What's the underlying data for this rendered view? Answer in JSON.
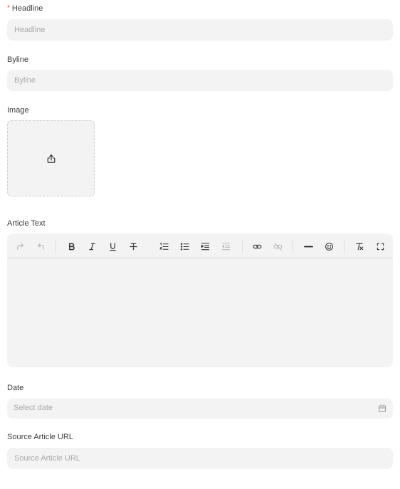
{
  "headline": {
    "label": "Headline",
    "required_mark": "*",
    "placeholder": "Headline"
  },
  "byline": {
    "label": "Byline",
    "placeholder": "Byline"
  },
  "image": {
    "label": "Image",
    "upload_icon": "upload-icon"
  },
  "article_text": {
    "label": "Article Text",
    "toolbar": [
      "redo-icon",
      "undo-icon",
      "bold-icon",
      "italic-icon",
      "underline-icon",
      "strikethrough-icon",
      "ordered-list-icon",
      "bullet-list-icon",
      "indent-icon",
      "outdent-icon",
      "link-icon",
      "unlink-icon",
      "horizontal-rule-icon",
      "emoji-icon",
      "clear-format-icon",
      "fullscreen-icon"
    ]
  },
  "date": {
    "label": "Date",
    "placeholder": "Select date",
    "icon": "calendar-icon"
  },
  "source_url": {
    "label": "Source Article URL",
    "placeholder": "Source Article URL"
  },
  "colors": {
    "field_bg": "#f3f3f3",
    "required": "#e5484d",
    "placeholder": "#a9a9a9"
  }
}
